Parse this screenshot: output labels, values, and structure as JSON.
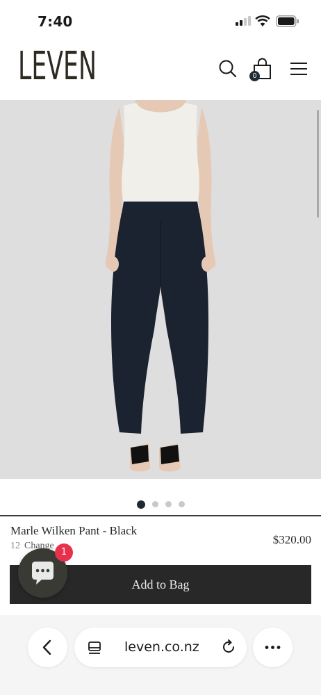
{
  "status_bar": {
    "time": "7:40"
  },
  "header": {
    "logo_text": "LEVEN",
    "bag_count": "0"
  },
  "product": {
    "name": "Marle Wilken Pant - Black",
    "price": "$320.00",
    "meta_number": "12",
    "meta_label": "Change",
    "add_to_bag_label": "Add to Bag"
  },
  "carousel": {
    "slide_count": 4,
    "active_index": 0
  },
  "chat": {
    "badge_count": "1"
  },
  "browser": {
    "url": "leven.co.nz"
  },
  "colors": {
    "image_background": "#dedede",
    "add_button": "#282828",
    "chat_widget": "#3a3a34",
    "chat_badge": "#e9304b",
    "active_dot": "#1f2a33"
  },
  "icons": [
    "search-icon",
    "bag-icon",
    "menu-icon",
    "chat-icon",
    "back-icon",
    "tabs-icon",
    "reload-icon",
    "more-icon",
    "signal-icon",
    "wifi-icon",
    "battery-icon"
  ]
}
